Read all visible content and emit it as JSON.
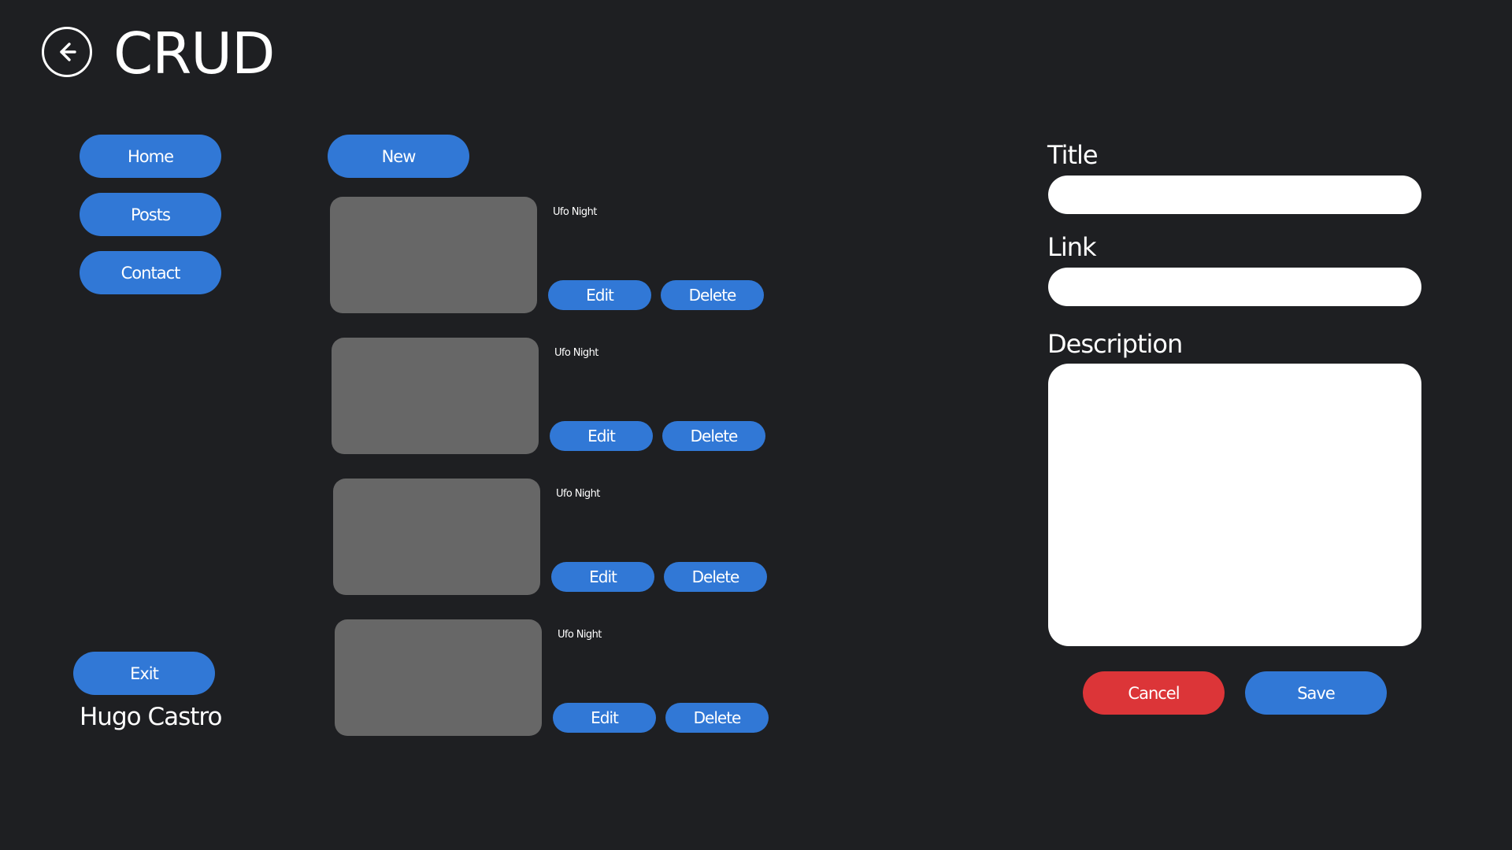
{
  "header": {
    "back_icon": "arrow-left-circle-icon",
    "title": "CRUD"
  },
  "sidebar": {
    "items": [
      {
        "label": "Home"
      },
      {
        "label": "Posts"
      },
      {
        "label": "Contact"
      }
    ],
    "exit_label": "Exit",
    "user_name": "Hugo Castro"
  },
  "posts": {
    "new_label": "New",
    "items": [
      {
        "title": "Ufo Night",
        "edit_label": "Edit",
        "delete_label": "Delete"
      },
      {
        "title": "Ufo Night",
        "edit_label": "Edit",
        "delete_label": "Delete"
      },
      {
        "title": "Ufo Night",
        "edit_label": "Edit",
        "delete_label": "Delete"
      },
      {
        "title": "Ufo Night",
        "edit_label": "Edit",
        "delete_label": "Delete"
      }
    ]
  },
  "form": {
    "title_label": "Title",
    "title_value": "",
    "link_label": "Link",
    "link_value": "",
    "description_label": "Description",
    "description_value": "",
    "cancel_label": "Cancel",
    "save_label": "Save"
  },
  "colors": {
    "background": "#1e1f22",
    "primary": "#3178d6",
    "danger": "#dc3538",
    "thumbnail": "#676767"
  }
}
